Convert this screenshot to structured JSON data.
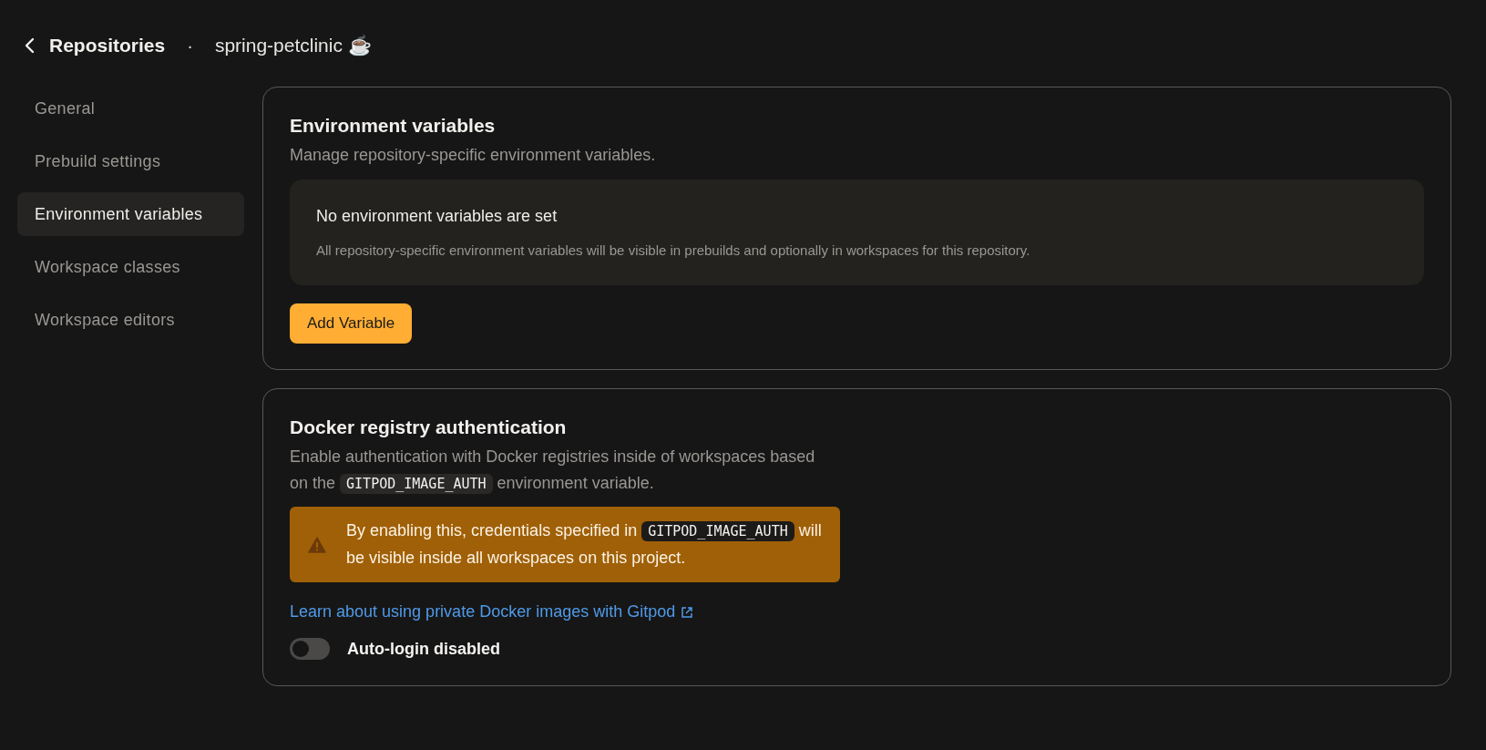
{
  "header": {
    "back_label": "Repositories",
    "separator": "·",
    "repository": "spring-petclinic ☕"
  },
  "sidebar": {
    "items": [
      {
        "label": "General",
        "selected": false
      },
      {
        "label": "Prebuild settings",
        "selected": false
      },
      {
        "label": "Environment variables",
        "selected": true
      },
      {
        "label": "Workspace classes",
        "selected": false
      },
      {
        "label": "Workspace editors",
        "selected": false
      }
    ]
  },
  "environment_variables": {
    "title": "Environment variables",
    "description": "Manage repository-specific environment variables.",
    "empty_title": "No environment variables are set",
    "empty_text": "All repository-specific environment variables will be visible in prebuilds and optionally in workspaces for this repository.",
    "button": "Add Variable"
  },
  "docker_registry": {
    "title": "Docker registry authentication",
    "description": [
      {
        "kind": "text",
        "text": "Enable authentication with Docker registries inside of workspaces based on the "
      },
      {
        "kind": "code",
        "text": "GITPOD_IMAGE_AUTH"
      },
      {
        "kind": "text",
        "text": " environment variable."
      }
    ],
    "warning": [
      {
        "kind": "text",
        "text": "By enabling this, credentials specified in "
      },
      {
        "kind": "code",
        "text": "GITPOD_IMAGE_AUTH"
      },
      {
        "kind": "text",
        "text": " will be visible inside all workspaces on this project."
      }
    ],
    "link": "Learn about using private Docker images with Gitpod",
    "toggle": {
      "label": "Auto-login disabled",
      "on": false
    }
  }
}
